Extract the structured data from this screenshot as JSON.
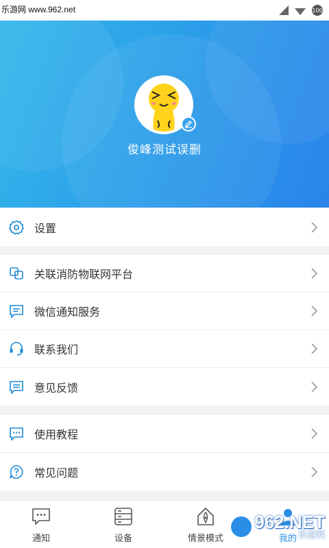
{
  "status_bar": {
    "watermark": "乐游网 www.962.net"
  },
  "profile": {
    "username": "俊峰测试误删"
  },
  "menu_groups": [
    [
      {
        "label": "设置",
        "icon": "gear-icon"
      }
    ],
    [
      {
        "label": "关联消防物联网平台",
        "icon": "link-platform-icon"
      },
      {
        "label": "微信通知服务",
        "icon": "message-icon"
      },
      {
        "label": "联系我们",
        "icon": "headset-icon"
      },
      {
        "label": "意见反馈",
        "icon": "feedback-icon"
      }
    ],
    [
      {
        "label": "使用教程",
        "icon": "tutorial-icon"
      },
      {
        "label": "常见问题",
        "icon": "question-icon"
      }
    ]
  ],
  "tabbar": [
    {
      "label": "通知",
      "icon": "notification-icon"
    },
    {
      "label": "设备",
      "icon": "device-icon"
    },
    {
      "label": "情景模式",
      "icon": "scene-icon"
    },
    {
      "label": "我的",
      "icon": "profile-icon"
    }
  ],
  "watermark": {
    "brand": "962.NET",
    "sub": "乐游网"
  },
  "colors": {
    "accent": "#2a8ee6",
    "icon": "#1e8ad6",
    "header_start": "#33b7ea",
    "header_end": "#2a84ea"
  }
}
